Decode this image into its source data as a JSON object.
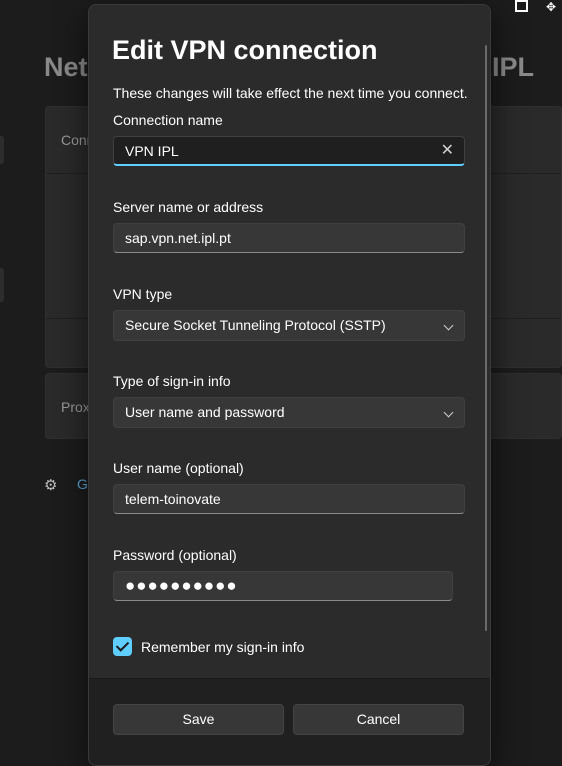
{
  "background": {
    "title_left": "Net",
    "title_right": "IPL",
    "row1_label": "Conn",
    "row2_label": "Prox",
    "link_text": "Ge"
  },
  "dialog": {
    "title": "Edit VPN connection",
    "subtitle": "These changes will take effect the next time you connect.",
    "connection_name": {
      "label": "Connection name",
      "value": "VPN IPL"
    },
    "server": {
      "label": "Server name or address",
      "value": "sap.vpn.net.ipl.pt"
    },
    "vpn_type": {
      "label": "VPN type",
      "value": "Secure Socket Tunneling Protocol (SSTP)"
    },
    "signin_type": {
      "label": "Type of sign-in info",
      "value": "User name and password"
    },
    "username": {
      "label": "User name (optional)",
      "value": "telem-toinovate"
    },
    "password": {
      "label": "Password (optional)",
      "value": "●●●●●●●●●●"
    },
    "remember": {
      "label": "Remember my sign-in info",
      "checked": true
    },
    "save_label": "Save",
    "cancel_label": "Cancel"
  },
  "colors": {
    "accent": "#60cdff",
    "dialog_bg": "#2b2b2b",
    "footer_bg": "#202020"
  }
}
